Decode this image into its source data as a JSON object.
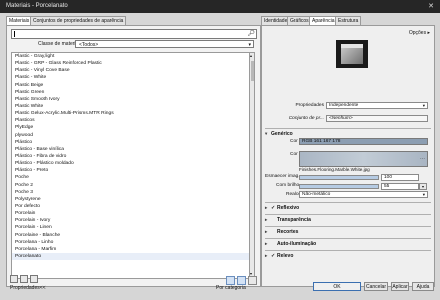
{
  "window": {
    "title": "Materiais - Porcelanato",
    "close_glyph": "✕"
  },
  "left_tabs": [
    "Materiais",
    "Conjuntos de propriedades de aparência"
  ],
  "search": {
    "value": "",
    "placeholder": ""
  },
  "class_filter": {
    "label": "Classe de material:",
    "value": "<Todos>"
  },
  "materials": [
    "Plastic - Gray,light",
    "Plastic - GRP - Glass Reinforced Plastic",
    "Plastic - Vinyl Cove Base",
    "Plastic - White",
    "Plastic Beige",
    "Plastic Green",
    "Plastic Smooth Ivory",
    "Plastic White",
    "Plastic Gelux-Acrylic.Multi-Prisms.MTR Rings",
    "Plasticos",
    "PlyEdge",
    "plywood",
    "Plástico",
    "Plástico - Base vinílica",
    "Plástico - Fibra de vidro",
    "Plástico - Plástico moldado",
    "Plástico - Preto",
    "Poche",
    "Poche 2",
    "Poche 3",
    "Polystyrene",
    "Por defecto",
    "Porcelain",
    "Porcelain - Ivory",
    "Porcelain - Linen",
    "Porcelaine - Blanche",
    "Porcelana - Linho",
    "Porcelana - Marfim",
    "Porcelanato",
    "",
    "",
    ""
  ],
  "right_tabs": [
    "Identidade",
    "Gráficos",
    "Aparência",
    "Estrutura"
  ],
  "options_label": "Opções ▸",
  "appearance": {
    "properties_label": "Propriedades",
    "properties_value": "Independente",
    "set_label": "Conjunto de pr...",
    "set_value": "<Nenhum>",
    "generic_header": "Genérico",
    "color_label": "Cor",
    "color_value": "RGB 161 167 178",
    "image_label": "Cor",
    "image_name": "Finishes.Flooring.Marble.White.jpg",
    "fade_label": "Esmaecer imag...",
    "fade_value": "100",
    "gloss_label": "Com brilho",
    "gloss_value": "55",
    "highlights_label": "Realces",
    "highlights_value": "Não-metálico",
    "sections": [
      "Reflexivo",
      "Transparência",
      "Recortes",
      "Auto-iluminação",
      "Relevo"
    ],
    "sections_checked": [
      true,
      false,
      false,
      false,
      true
    ]
  },
  "footer": {
    "properties": "Propriedades<<",
    "by_category": "Por categoria",
    "ok": "OK",
    "cancel": "Cancelar",
    "apply": "Aplicar",
    "help": "Ajuda"
  }
}
